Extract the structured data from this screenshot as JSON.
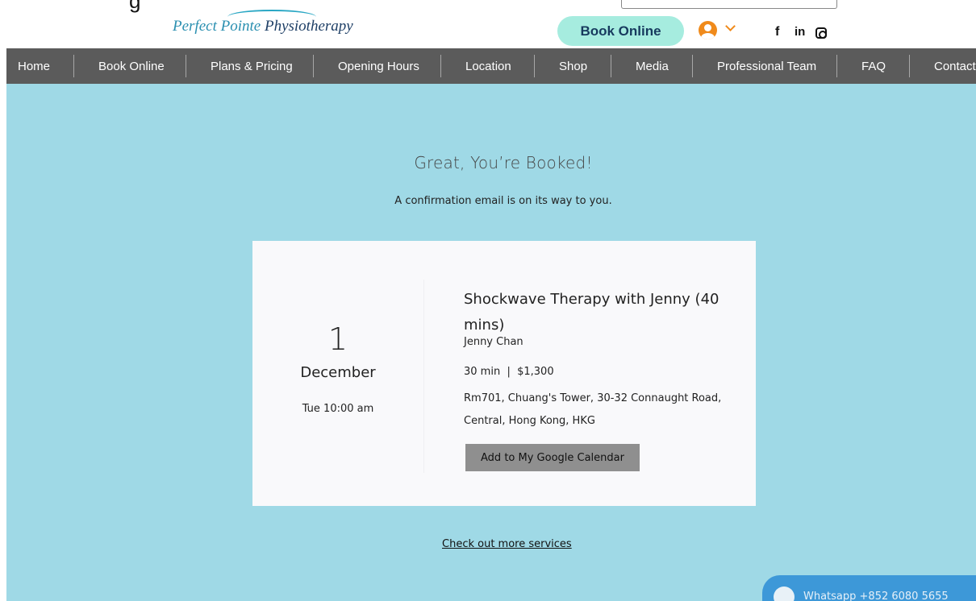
{
  "top_fragment": {
    "text": "g"
  },
  "header": {
    "logo": {
      "part1": "Perfect Pointe ",
      "part2": "Physiotherapy"
    },
    "book_online": "Book Online",
    "social": {
      "facebook": "f",
      "linkedin": "in"
    }
  },
  "nav": {
    "items": [
      {
        "label": "Home"
      },
      {
        "label": "Book Online"
      },
      {
        "label": "Plans & Pricing"
      },
      {
        "label": "Opening Hours"
      },
      {
        "label": "Location"
      },
      {
        "label": "Shop"
      },
      {
        "label": "Media"
      },
      {
        "label": "Professional Team"
      },
      {
        "label": "FAQ"
      },
      {
        "label": "Contact"
      }
    ]
  },
  "confirmation": {
    "title": "Great, You’re Booked!",
    "subtitle": "A confirmation email is on its way to you."
  },
  "booking": {
    "day": "1",
    "month": "December",
    "weekday_time": "Tue 10:00 am",
    "service": "Shockwave Therapy with Jenny (40 mins)",
    "staff": "Jenny Chan",
    "duration_price": "30 min  |  $1,300",
    "address": "Rm701, Chuang's Tower, 30-32 Connaught Road, Central, Hong Kong, HKG",
    "calendar_button": "Add to My Google Calendar"
  },
  "more_link": "Check out more services",
  "whatsapp": {
    "text": "Whatsapp +852 6080 5655"
  },
  "colors": {
    "nav_bg": "#5b5b5b",
    "page_bg": "#9fd9e6",
    "book_pill": "#a6ecdf",
    "accent_orange": "#f08a1a",
    "whatsapp_bg": "#3d98d8"
  }
}
